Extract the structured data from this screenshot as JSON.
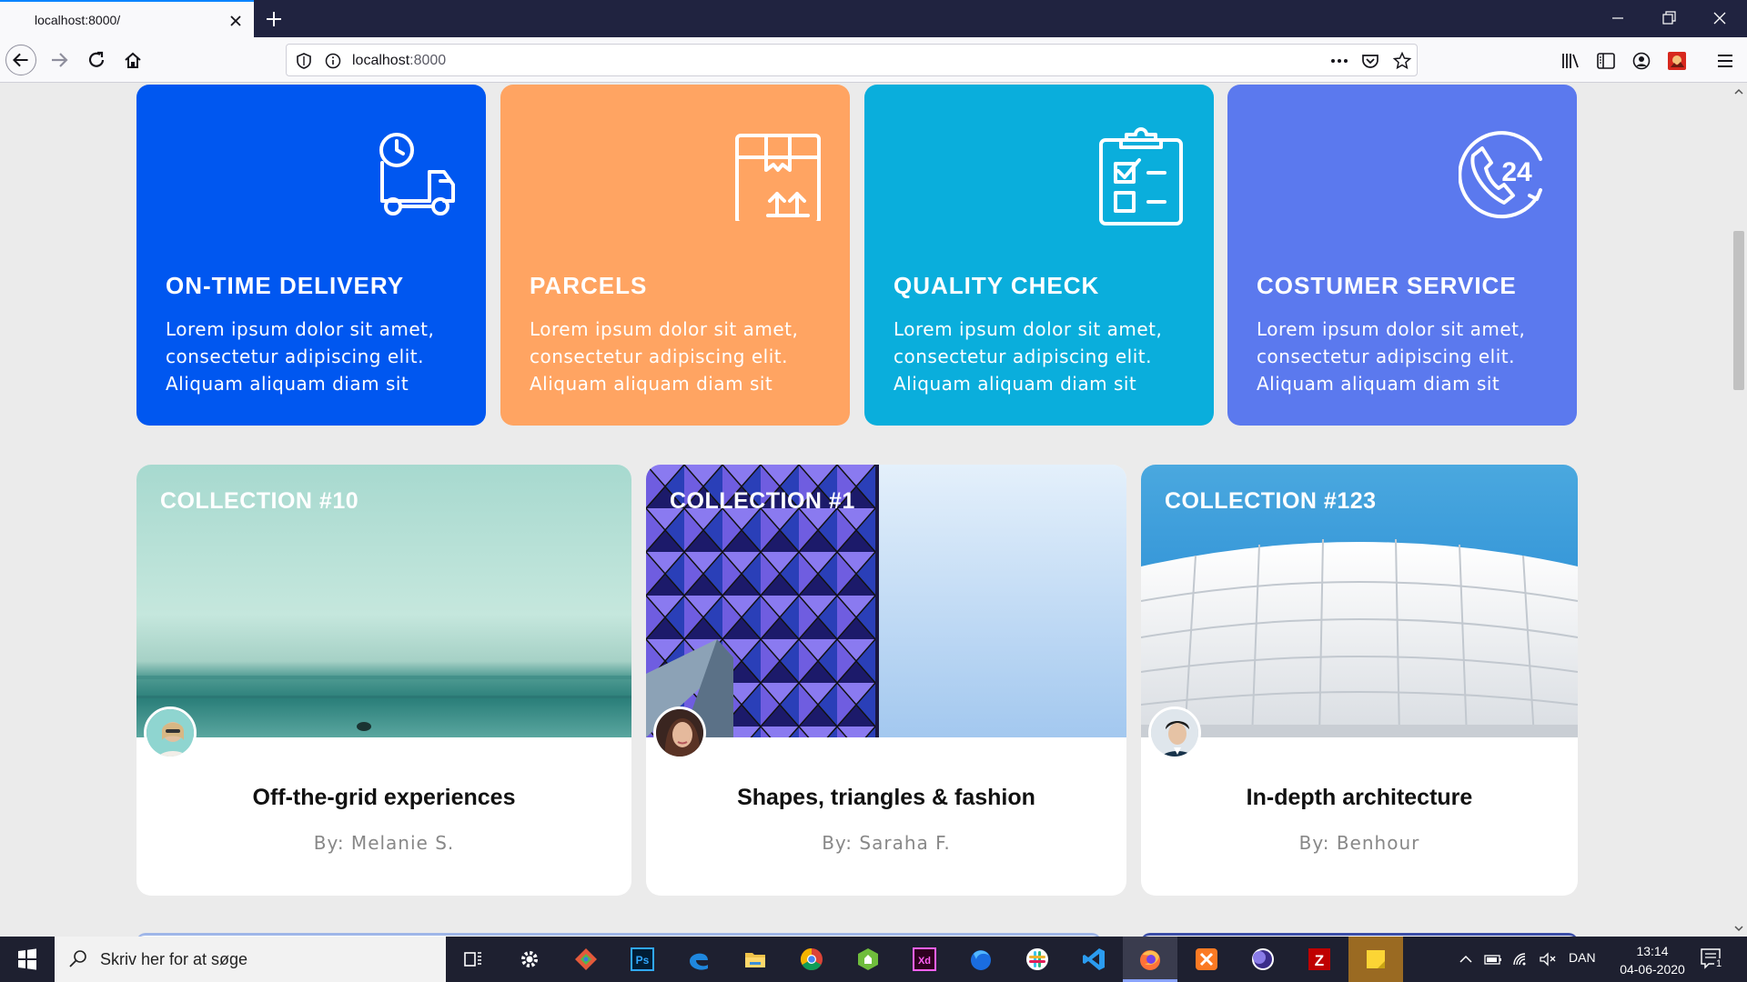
{
  "browser": {
    "tab_title": "localhost:8000/",
    "url_host": "localhost",
    "url_port": ":8000"
  },
  "features": [
    {
      "title": "ON-TIME DELIVERY",
      "text": "Lorem ipsum dolor sit amet, consectetur adipiscing elit. Aliquam aliquam diam sit",
      "color": "#0057f0",
      "icon": "delivery-truck-icon"
    },
    {
      "title": "PARCELS",
      "text": "Lorem ipsum dolor sit amet, consectetur adipiscing elit. Aliquam aliquam diam sit",
      "color": "#ffa462",
      "icon": "parcel-box-icon"
    },
    {
      "title": "QUALITY CHECK",
      "text": "Lorem ipsum dolor sit amet, consectetur adipiscing elit. Aliquam aliquam diam sit",
      "color": "#0aaedc",
      "icon": "clipboard-checklist-icon"
    },
    {
      "title": "COSTUMER SERVICE",
      "text": "Lorem ipsum dolor sit amet, consectetur adipiscing elit. Aliquam aliquam diam sit",
      "color": "#5b79ee",
      "icon": "phone-24-icon"
    }
  ],
  "collections": [
    {
      "tag": "COLLECTION #10",
      "title": "Off-the-grid experiences",
      "author": "By: Melanie S."
    },
    {
      "tag": "COLLECTION #1",
      "title": "Shapes, triangles & fashion",
      "author": "By: Saraha F."
    },
    {
      "tag": "COLLECTION #123",
      "title": "In-depth architecture",
      "author": "By: Benhour"
    }
  ],
  "taskbar": {
    "search_placeholder": "Skriv her for at søge",
    "language": "DAN",
    "time": "13:14",
    "date": "04-06-2020",
    "notification_count": "1"
  }
}
